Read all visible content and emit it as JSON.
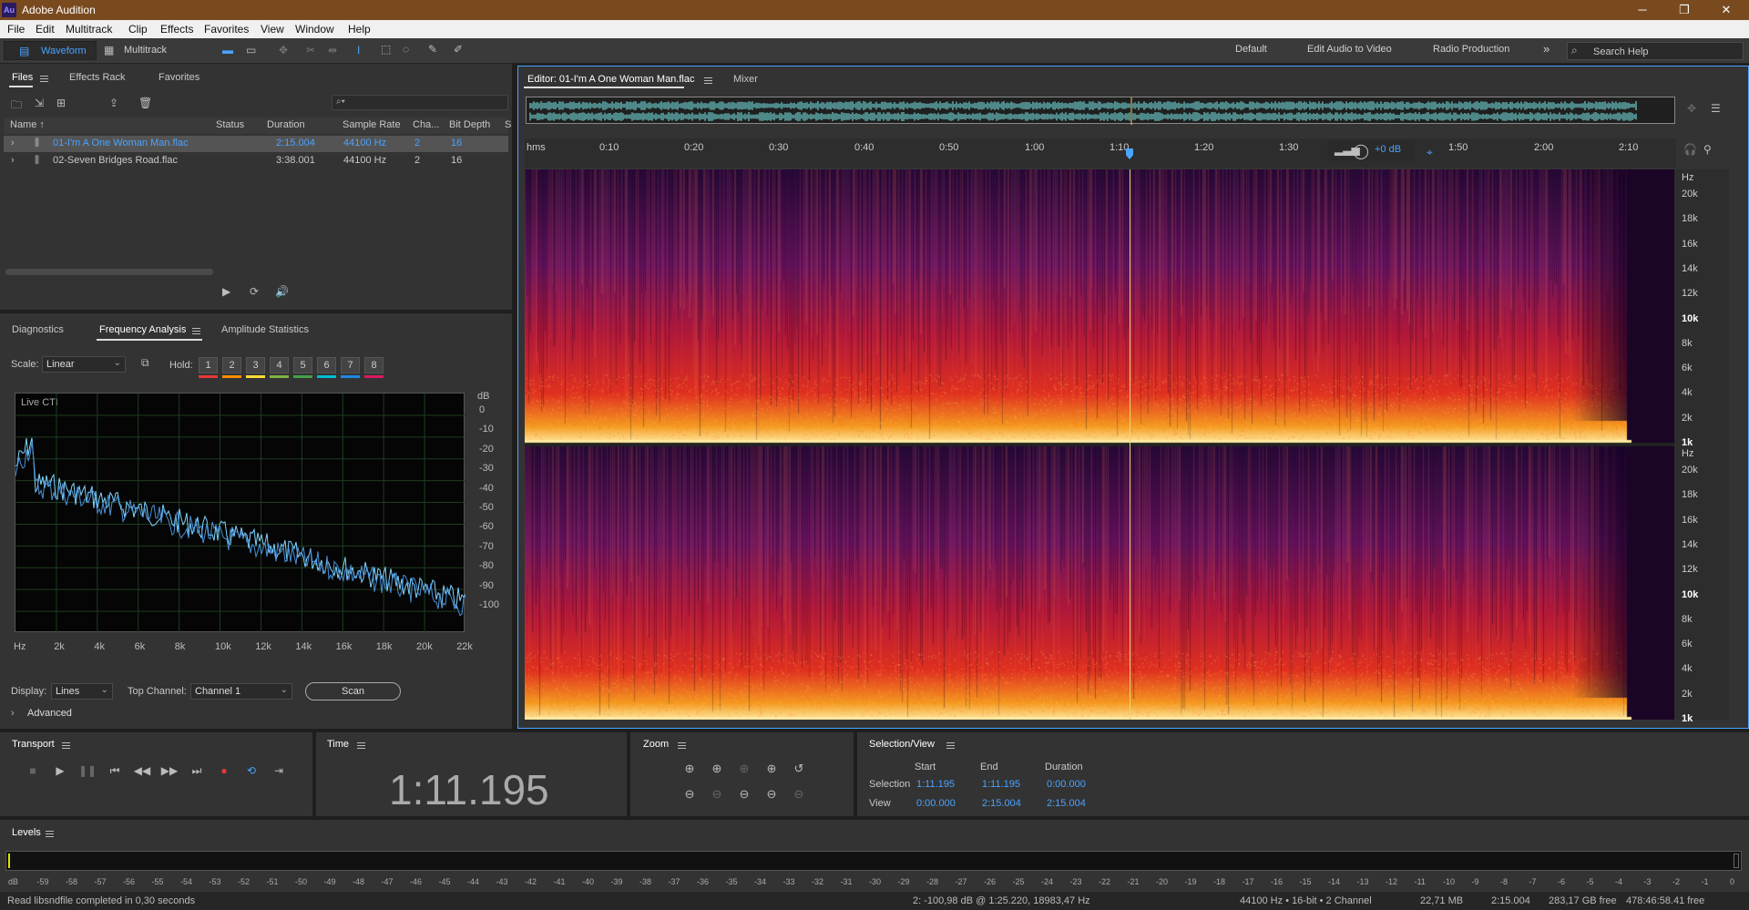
{
  "window": {
    "logo": "Au",
    "title": "Adobe Audition",
    "controls": [
      "─",
      "❐",
      "✕"
    ]
  },
  "menu": [
    "File",
    "Edit",
    "Multitrack",
    "Clip",
    "Effects",
    "Favorites",
    "View",
    "Window",
    "Help"
  ],
  "toolbar": {
    "waveform_label": "Waveform",
    "multitrack_label": "Multitrack",
    "workspaces": [
      "Default",
      "Edit Audio to Video",
      "Radio Production"
    ],
    "more": "»",
    "search_placeholder": "Search Help"
  },
  "files_panel": {
    "tabs": [
      "Files",
      "Effects Rack",
      "Favorites"
    ],
    "search_glyph": "⌕▾",
    "columns": [
      "Name ↑",
      "Status",
      "Duration",
      "Sample Rate",
      "Cha...",
      "Bit Depth",
      "S"
    ],
    "rows": [
      {
        "expand": "›",
        "name": "01-I'm A One Woman Man.flac",
        "status": "",
        "duration": "2:15.004",
        "rate": "44100 Hz",
        "channels": "2",
        "depth": "16",
        "selected": true
      },
      {
        "expand": "›",
        "name": "02-Seven Bridges Road.flac",
        "status": "",
        "duration": "3:38.001",
        "rate": "44100 Hz",
        "channels": "2",
        "depth": "16",
        "selected": false
      }
    ]
  },
  "analysis_panel": {
    "tabs": [
      "Diagnostics",
      "Frequency Analysis",
      "Amplitude Statistics"
    ],
    "scale_label": "Scale:",
    "scale_value": "Linear",
    "hold_label": "Hold:",
    "hold_buttons": [
      "1",
      "2",
      "3",
      "4",
      "5",
      "6",
      "7",
      "8"
    ],
    "hold_colors": [
      "#e53935",
      "#fb8c00",
      "#fdd835",
      "#7cb342",
      "#43a047",
      "#00bcd4",
      "#1e88e5",
      "#d81b60"
    ],
    "live_label": "Live CTI",
    "db_unit": "dB",
    "db_ticks": [
      "0",
      "-10",
      "-20",
      "-30",
      "-40",
      "-50",
      "-60",
      "-70",
      "-80",
      "-90",
      "-100"
    ],
    "freq_ticks": [
      "Hz",
      "2k",
      "4k",
      "6k",
      "8k",
      "10k",
      "12k",
      "14k",
      "16k",
      "18k",
      "20k",
      "22k"
    ],
    "display_label": "Display:",
    "display_value": "Lines",
    "top_channel_label": "Top Channel:",
    "top_channel_value": "Channel 1",
    "scan_label": "Scan",
    "advanced_label": "Advanced"
  },
  "editor": {
    "tab_label": "Editor: 01-I'm A One Woman Man.flac",
    "mixer_label": "Mixer",
    "ruler": [
      "hms",
      "0:10",
      "0:20",
      "0:30",
      "0:40",
      "0:50",
      "1:00",
      "1:10",
      "1:20",
      "1:30",
      "1:40",
      "1:50",
      "2:00",
      "2:10"
    ],
    "gain_label": "+0 dB",
    "hz_upper": [
      "Hz",
      "20k",
      "18k",
      "16k",
      "14k",
      "12k",
      "10k",
      "8k",
      "6k",
      "4k",
      "2k",
      "1k"
    ],
    "hz_lower": [
      "Hz",
      "20k",
      "18k",
      "16k",
      "14k",
      "12k",
      "10k",
      "8k",
      "6k",
      "4k",
      "2k",
      "1k"
    ]
  },
  "transport": {
    "title": "Transport",
    "buttons": [
      "■",
      "▶",
      "❚❚",
      "⏮",
      "◀◀",
      "▶▶",
      "⏭",
      "●",
      "⟲",
      "⇥"
    ]
  },
  "time_panel": {
    "title": "Time",
    "value": "1:11.195"
  },
  "zoom_panel": {
    "title": "Zoom"
  },
  "selection_view": {
    "title": "Selection/View",
    "headers": [
      "Start",
      "End",
      "Duration"
    ],
    "selection_label": "Selection",
    "selection": [
      "1:11.195",
      "1:11.195",
      "0:00.000"
    ],
    "view_label": "View",
    "view": [
      "0:00.000",
      "2:15.004",
      "2:15.004"
    ]
  },
  "levels": {
    "title": "Levels",
    "db_ticks": [
      "dB",
      "-59",
      "-58",
      "-57",
      "-56",
      "-55",
      "-54",
      "-53",
      "-52",
      "-51",
      "-50",
      "-49",
      "-48",
      "-47",
      "-46",
      "-45",
      "-44",
      "-43",
      "-42",
      "-41",
      "-40",
      "-39",
      "-38",
      "-37",
      "-36",
      "-35",
      "-34",
      "-33",
      "-32",
      "-31",
      "-30",
      "-29",
      "-28",
      "-27",
      "-26",
      "-25",
      "-24",
      "-23",
      "-22",
      "-21",
      "-20",
      "-19",
      "-18",
      "-17",
      "-16",
      "-15",
      "-14",
      "-13",
      "-12",
      "-11",
      "-10",
      "-9",
      "-8",
      "-7",
      "-6",
      "-5",
      "-4",
      "-3",
      "-2",
      "-1",
      "0"
    ]
  },
  "status": {
    "message": "Read libsndfile completed in 0,30 seconds",
    "cursor_info": "2: -100,98 dB @ 1:25.220, 18983,47 Hz",
    "format": "44100 Hz • 16-bit • 2 Channel",
    "size": "22,71 MB",
    "duration": "2:15.004",
    "free": "283,17 GB free",
    "free_time": "478:46:58.41 free"
  },
  "colors": {
    "accent": "#4aa3ff",
    "titlebar": "#7a4a1f",
    "playhead": "#e8d77a"
  }
}
